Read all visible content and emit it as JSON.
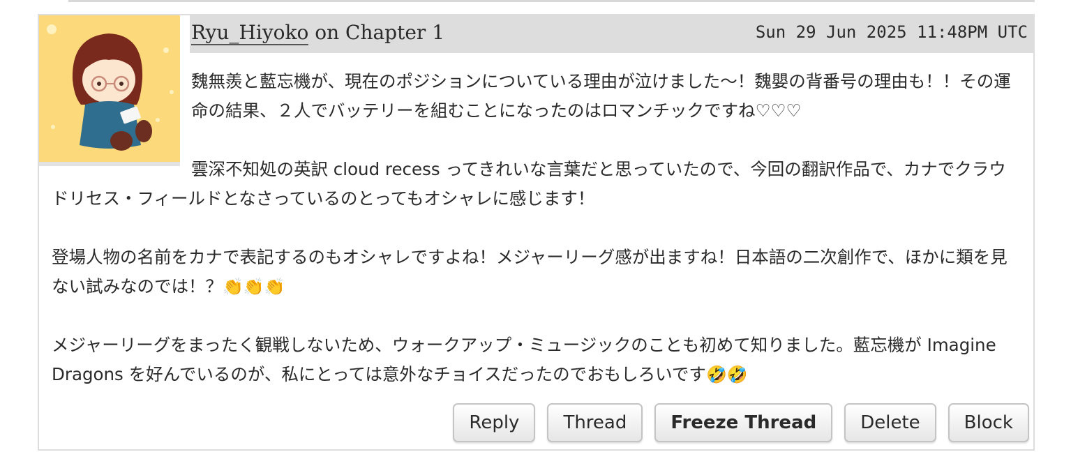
{
  "comment": {
    "author": "Ryu_Hiyoko",
    "on_text": " on ",
    "chapter": "Chapter 1",
    "datetime": "Sun 29 Jun 2025 11:48PM UTC",
    "paragraphs": [
      "魏無羨と藍忘機が、現在のポジションについている理由が泣けました〜！魏嬰の背番号の理由も！！その運命の結果、２人でバッテリーを組むことになったのはロマンチックですね♡♡♡",
      "雲深不知処の英訳 cloud recess ってきれいな言葉だと思っていたので、今回の翻訳作品で、カナでクラウドリセス・フィールドとなさっているのとってもオシャレに感じます！",
      "登場人物の名前をカナで表記するのもオシャレですよね！メジャーリーグ感が出ますね！日本語の二次創作で、ほかに類を見ない試みなのでは！？",
      "メジャーリーグをまったく観戦しないため、ウォークアップ・ミュージックのことも初めて知りました。藍忘機が Imagine Dragons を好んでいるのが、私にとっては意外なチョイスだったのでおもしろいです"
    ],
    "emoji_clap": "👏👏👏",
    "emoji_rofl": "🤣🤣"
  },
  "actions": {
    "reply": "Reply",
    "thread": "Thread",
    "freeze_thread": "Freeze Thread",
    "delete": "Delete",
    "block": "Block"
  },
  "colors": {
    "heading_bg": "#dddddd",
    "avatar_bg": "#fcd97a",
    "text": "#2a2a2a"
  }
}
